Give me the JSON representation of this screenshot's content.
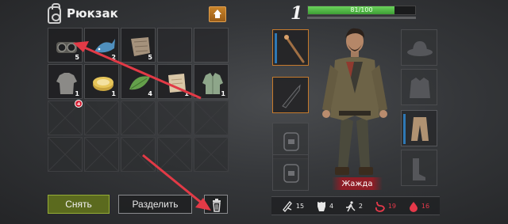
{
  "inventory": {
    "title": "Рюкзак",
    "rows": [
      [
        {
          "kind": "item",
          "icon": "goggles-icon",
          "count": "5"
        },
        {
          "kind": "item",
          "icon": "fish-icon",
          "count": "2"
        },
        {
          "kind": "item",
          "icon": "cloth-icon",
          "count": "5"
        },
        {
          "kind": "empty"
        },
        {
          "kind": "empty"
        }
      ],
      [
        {
          "kind": "item",
          "icon": "shirt-icon",
          "count": "1"
        },
        {
          "kind": "item",
          "icon": "canned-food-icon",
          "count": "1"
        },
        {
          "kind": "item",
          "icon": "leaves-icon",
          "count": "4"
        },
        {
          "kind": "item",
          "icon": "paper-icon",
          "count": "1"
        },
        {
          "kind": "item",
          "icon": "jacket-icon",
          "count": "1"
        }
      ],
      [
        {
          "kind": "locked"
        },
        {
          "kind": "locked"
        },
        {
          "kind": "locked"
        },
        {
          "kind": "locked"
        },
        {
          "kind": "locked"
        }
      ],
      [
        {
          "kind": "locked"
        },
        {
          "kind": "locked"
        },
        {
          "kind": "locked"
        },
        {
          "kind": "locked"
        },
        {
          "kind": "locked"
        }
      ]
    ],
    "take_label": "Снять",
    "split_label": "Разделить"
  },
  "character": {
    "level": "1",
    "xp_text": "81/100",
    "xp_fraction": 0.81,
    "status_label": "Жажда",
    "stats": [
      {
        "icon": "melee-icon",
        "value": "15",
        "color": "#e8e8e8"
      },
      {
        "icon": "armor-icon",
        "value": "4",
        "color": "#e8e8e8"
      },
      {
        "icon": "speed-icon",
        "value": "2",
        "color": "#e8e8e8"
      },
      {
        "icon": "stomach-icon",
        "value": "19",
        "color": "#e5394a"
      },
      {
        "icon": "water-drop-icon",
        "value": "16",
        "color": "#e5394a"
      }
    ]
  },
  "colors": {
    "accent_green": "#95ad36",
    "arrow_red": "#e23a46",
    "slot_orange": "#c67a2c"
  }
}
